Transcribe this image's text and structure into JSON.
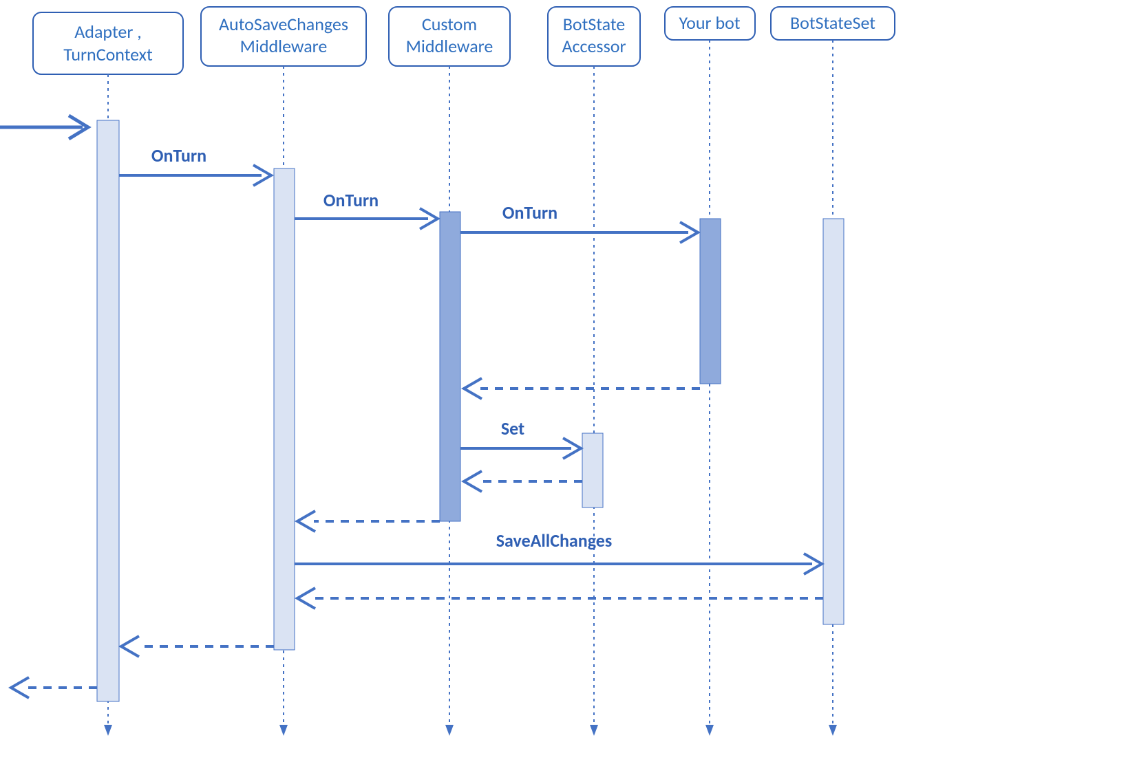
{
  "diagram_type": "sequence",
  "participants": {
    "adapter": {
      "line1": "Adapter ,",
      "line2": "TurnContext"
    },
    "autosave": {
      "line1": "AutoSaveChanges",
      "line2": "Middleware"
    },
    "custom": {
      "line1": "Custom",
      "line2": "Middleware"
    },
    "accessor": {
      "line1": "BotState",
      "line2": "Accessor"
    },
    "yourbot": {
      "line1": "Your bot"
    },
    "stateset": {
      "line1": "BotStateSet"
    }
  },
  "messages": {
    "onturn1": "OnTurn",
    "onturn2": "OnTurn",
    "onturn3": "OnTurn",
    "set": "Set",
    "saveall": "SaveAllChanges"
  },
  "colors": {
    "stroke": "#4472c4",
    "text": "#2f6fbf",
    "light_fill": "#dae3f3",
    "dark_fill": "#8faadc"
  }
}
